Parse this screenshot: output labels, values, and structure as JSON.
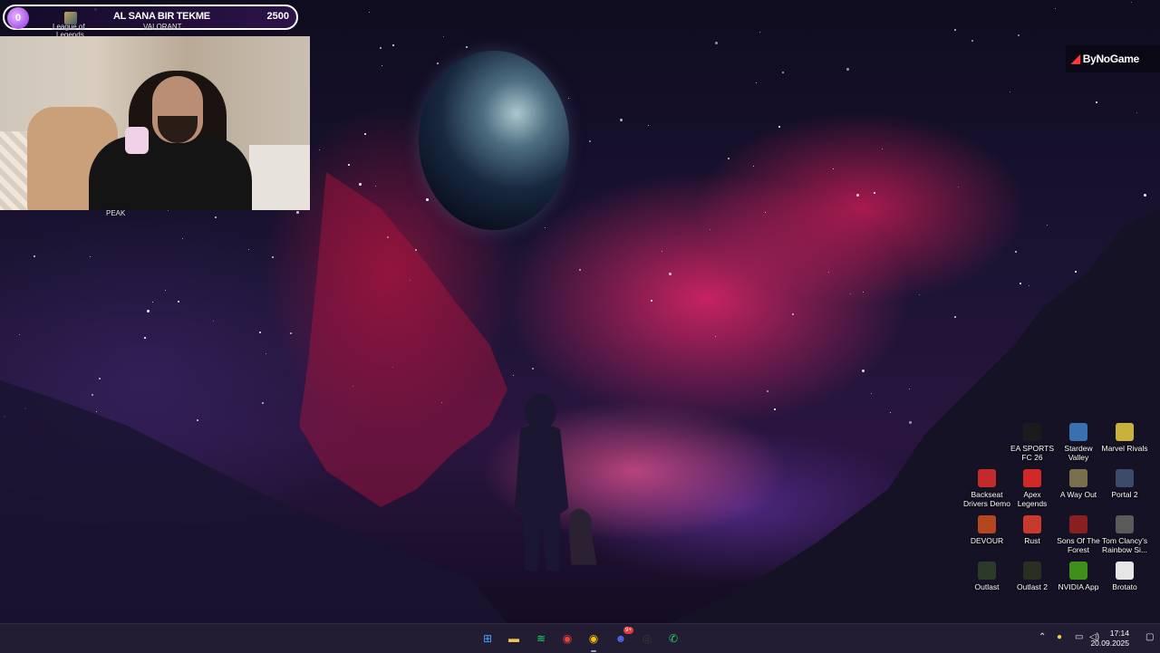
{
  "overlay": {
    "alert_avatar_label": "0",
    "alert_title": "AL SANA BIR TEKME",
    "alert_amount": "2500",
    "game_top_label_1": "League of",
    "game_top_label_2": "Legends",
    "game_top_label_3": "VALORANT",
    "game_under_cam": "PEAK"
  },
  "brand": {
    "name": "ByNoGame"
  },
  "desktop_icons": [
    {
      "label": "EA SPORTS FC 26",
      "icon": "ea-fc-icon",
      "color": "#1b1b1b"
    },
    {
      "label": "Stardew Valley",
      "icon": "stardew-icon",
      "color": "#3a6fb0"
    },
    {
      "label": "Marvel Rivals",
      "icon": "marvel-rivals-icon",
      "color": "#c9b13a"
    },
    {
      "label": "Backseat Drivers Demo",
      "icon": "backseat-drivers-icon",
      "color": "#c42a2a"
    },
    {
      "label": "Apex Legends",
      "icon": "apex-icon",
      "color": "#d22828"
    },
    {
      "label": "A Way Out",
      "icon": "a-way-out-icon",
      "color": "#7a6f4a"
    },
    {
      "label": "Portal 2",
      "icon": "portal2-icon",
      "color": "#3b4c6b"
    },
    {
      "label": "DEVOUR",
      "icon": "devour-icon",
      "color": "#b5471e"
    },
    {
      "label": "Rust",
      "icon": "rust-icon",
      "color": "#c83a2a"
    },
    {
      "label": "Sons Of The Forest",
      "icon": "sons-forest-icon",
      "color": "#8a1f1f"
    },
    {
      "label": "Tom Clancy's Rainbow Si...",
      "icon": "rainbow-six-icon",
      "color": "#5a5a5a"
    },
    {
      "label": "Outlast",
      "icon": "outlast-icon",
      "color": "#2c3a2a"
    },
    {
      "label": "Outlast 2",
      "icon": "outlast2-icon",
      "color": "#2a2f24"
    },
    {
      "label": "NVIDIA App",
      "icon": "nvidia-icon",
      "color": "#3f8f1a"
    },
    {
      "label": "Brotato",
      "icon": "brotato-icon",
      "color": "#e6e6e6"
    }
  ],
  "taskbar": {
    "apps": [
      {
        "name": "start-button",
        "glyph": "⊞",
        "color": "#4aa3ff"
      },
      {
        "name": "file-explorer-icon",
        "glyph": "▬",
        "color": "#f3c44b"
      },
      {
        "name": "spotify-icon",
        "glyph": "≋",
        "color": "#1ed760"
      },
      {
        "name": "chrome-icon",
        "glyph": "◉",
        "color": "#ea4335"
      },
      {
        "name": "chrome-alt-icon",
        "glyph": "◉",
        "color": "#fbbc05"
      },
      {
        "name": "discord-icon",
        "glyph": "☻",
        "color": "#5865f2"
      },
      {
        "name": "obs-icon",
        "glyph": "◎",
        "color": "#3a3a3a"
      },
      {
        "name": "whatsapp-icon",
        "glyph": "✆",
        "color": "#25d366"
      }
    ],
    "discord_badge": "9+",
    "time": "17:14",
    "date": "20.09.2025"
  }
}
